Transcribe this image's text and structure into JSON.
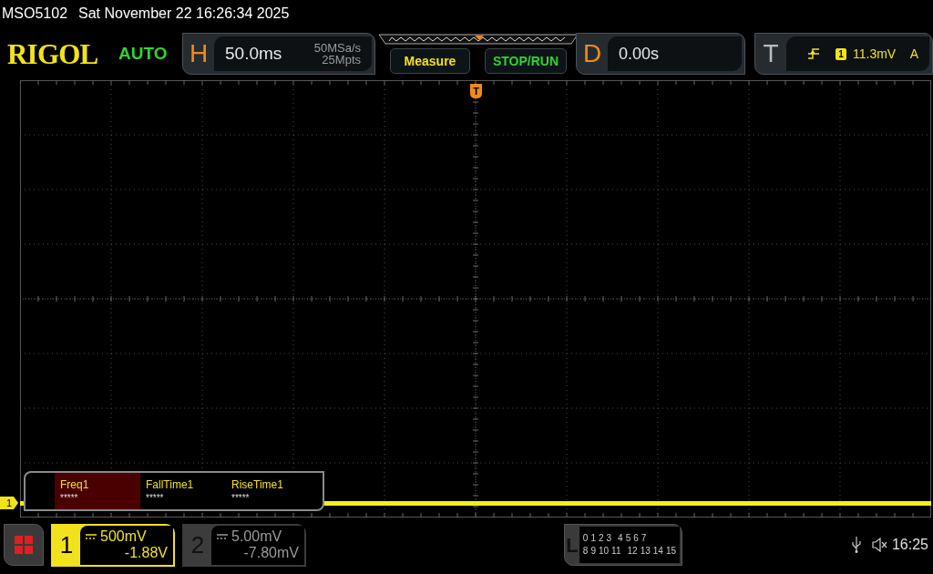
{
  "title_bar": {
    "model": "MSO5102",
    "datetime": "Sat November 22 16:26:34 2025"
  },
  "header": {
    "logo": "RIGOL",
    "trigger_status": "AUTO",
    "horizontal": {
      "label": "H",
      "timebase": "50.0ms",
      "sample_rate": "50MSa/s",
      "memory_depth": "25Mpts"
    },
    "buttons": [
      {
        "label": "Measure",
        "kind": "measure"
      },
      {
        "label": "STOP/RUN",
        "kind": "run"
      }
    ],
    "delay": {
      "label": "D",
      "value": "0.00s"
    },
    "trigger": {
      "label": "T",
      "source": "1",
      "level": "11.3mV",
      "mode": "A"
    }
  },
  "plot": {
    "trigger_marker": "T",
    "channel_marker": "1"
  },
  "measurements": [
    {
      "name": "Freq1",
      "value": "*****",
      "selected": true
    },
    {
      "name": "FallTime1",
      "value": "*****",
      "selected": false
    },
    {
      "name": "RiseTime1",
      "value": "*****",
      "selected": false
    }
  ],
  "channels": [
    {
      "number": "1",
      "scale": "500mV",
      "offset": "-1.88V",
      "active": true
    },
    {
      "number": "2",
      "scale": "5.00mV",
      "offset": "-7.80mV",
      "active": false
    }
  ],
  "logic": {
    "label": "L",
    "row_1": [
      "0",
      "1",
      "2",
      "3",
      "4",
      "5",
      "6",
      "7"
    ],
    "row_2": [
      "8",
      "9",
      "10",
      "11",
      "12",
      "13",
      "14",
      "15"
    ]
  },
  "status": {
    "time": "16:25"
  }
}
